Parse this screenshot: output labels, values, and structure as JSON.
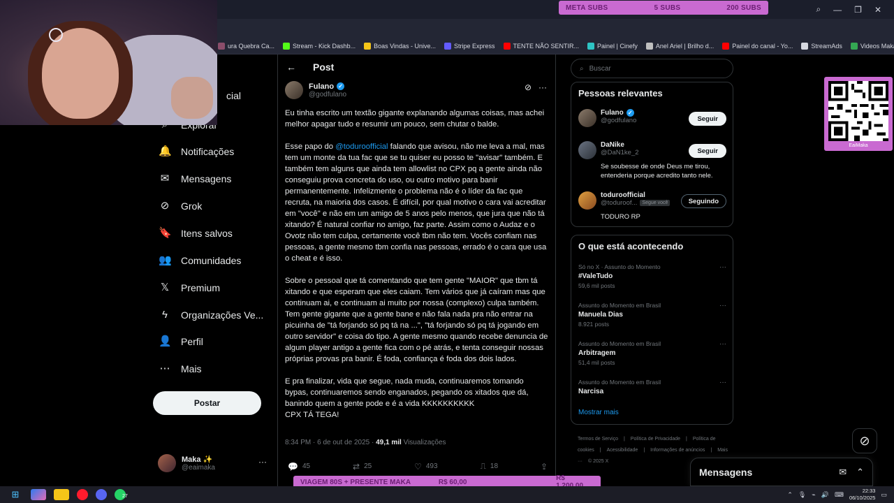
{
  "browser": {
    "bookmarks": [
      {
        "label": "ura Quebra Ca...",
        "icon": "bookmark-icon",
        "color": "#8b4d6a"
      },
      {
        "label": "Stream - Kick Dashb...",
        "icon": "kick-icon",
        "color": "#53fc18"
      },
      {
        "label": "Boas Vindas - Unive...",
        "icon": "star-icon",
        "color": "#f5c518"
      },
      {
        "label": "Stripe Express",
        "icon": "stripe-icon",
        "color": "#635bff"
      },
      {
        "label": "TENTE NÃO SENTIR...",
        "icon": "youtube-icon",
        "color": "#ff0000"
      },
      {
        "label": "Painel | Cinefy",
        "icon": "cinefy-icon",
        "color": "#2ec4c4"
      },
      {
        "label": "Anel Ariel | Brilho d...",
        "icon": "circle-icon",
        "color": "#bfbfbf"
      },
      {
        "label": "Painel do canal - Yo...",
        "icon": "youtube-icon",
        "color": "#ff0000"
      },
      {
        "label": "StreamAds",
        "icon": "file-icon",
        "color": "#d6d8e0"
      },
      {
        "label": "Videos Maka - Goo...",
        "icon": "drive-icon",
        "color": "#34a853"
      }
    ]
  },
  "overlay": {
    "meta_label": "META SUBS",
    "meta_current": "5 SUBS",
    "meta_goal": "200 SUBS",
    "viagem_label": "VIAGEM 80S + PRESENTE MAKA",
    "viagem_current": "R$ 60,00",
    "viagem_goal": "R$ 1.200,00",
    "qr_label": "EaiMaka"
  },
  "nav": {
    "partial_top": "cial",
    "partial_explore": "Explorar",
    "items": [
      {
        "label": "Notificações",
        "icon": "bell-icon",
        "glyph": "🔔"
      },
      {
        "label": "Mensagens",
        "icon": "mail-icon",
        "glyph": "✉"
      },
      {
        "label": "Grok",
        "icon": "grok-icon",
        "glyph": "⊘"
      },
      {
        "label": "Itens salvos",
        "icon": "bookmark-icon",
        "glyph": "🔖"
      },
      {
        "label": "Comunidades",
        "icon": "communities-icon",
        "glyph": "👥"
      },
      {
        "label": "Premium",
        "icon": "x-logo-icon",
        "glyph": "𝕏"
      },
      {
        "label": "Organizações Ve...",
        "icon": "lightning-icon",
        "glyph": "ϟ"
      },
      {
        "label": "Perfil",
        "icon": "person-icon",
        "glyph": "👤"
      },
      {
        "label": "Mais",
        "icon": "more-circle-icon",
        "glyph": "⋯"
      }
    ],
    "post_button": "Postar",
    "account": {
      "name": "Maka ✨",
      "handle": "@eaimaka",
      "more": "···"
    }
  },
  "post": {
    "header": "Post",
    "author_name": "Fulano",
    "author_handle": "@godfulano",
    "paragraphs": [
      "Eu tinha escrito um textão gigante explanando algumas coisas, mas achei melhor apagar tudo e resumir um pouco, sem chutar o balde.",
      "falando que avisou, não me leva a mal, mas tem um monte da tua fac que se tu quiser eu posso te \"avisar\" também. E também tem alguns que ainda tem allowlist no CPX pq a gente ainda não conseguiu prova concreta do uso, ou outro motivo para banir permanentemente. Infelizmente o problema não é o líder da fac que recruta, na maioria dos casos. É difícil, por qual motivo o cara vai acreditar em \"você\" e não em um amigo de 5 anos pelo menos, que jura que não tá xitando? É natural confiar no amigo, faz parte. Assim como o Audaz e o Ovotz não tem culpa, certamente você tbm não tem. Vocês confiam nas pessoas, a gente mesmo tbm confia nas pessoas, errado é o cara que usa o cheat e é isso.",
      "Sobre o pessoal que tá comentando que tem gente \"MAIOR\" que tbm tá xitando e que esperam que eles caiam. Tem vários que já caíram mas que continuam ai, e continuam ai muito por nossa (complexo) culpa também. Tem gente gigante que a gente bane e não fala nada pra não entrar na picuinha de \"tá forjando só pq tá na ...\", \"tá forjando só pq tá jogando em outro servidor\" e coisa do tipo. A gente mesmo quando recebe denuncia de algum player antigo a gente fica com o pé atrás, e tenta conseguir nossas próprias provas pra banir. É foda, confiança é foda dos dois lados.",
      "E pra finalizar, vida que segue, nada muda, continuaremos tomando bypas, continuaremos sendo enganados, pegando os xitados que dá, banindo quem a gente pode e é a vida KKKKKKKKKK\nCPX TÁ TEGA!"
    ],
    "p2_prefix": "Esse papo do ",
    "p2_mention": "@toduroofficial",
    "timestamp": "8:34 PM · 6 de out de 2025 · ",
    "views_count": "49,1 mil",
    "views_label": " Visualizações",
    "replies": "45",
    "reposts": "25",
    "likes": "493",
    "bookmarks": "18"
  },
  "sidebar": {
    "search_placeholder": "Buscar",
    "relevant_title": "Pessoas relevantes",
    "people": [
      {
        "name": "Fulano",
        "handle": "@godfulano",
        "verified": true,
        "bio": "",
        "button": "Seguir",
        "follows_you": ""
      },
      {
        "name": "DaNike",
        "handle": "@DaN1ke_2",
        "verified": false,
        "bio": "Se soubesse de onde Deus me tirou, entenderia porque acredito tanto nele.",
        "button": "Seguir",
        "follows_you": ""
      },
      {
        "name": "toduroofficial",
        "handle": "@toduroof...",
        "verified": false,
        "bio": "TODURO RP",
        "button": "Seguindo",
        "follows_you": "Segue você"
      }
    ],
    "trends_title": "O que está acontecendo",
    "trends": [
      {
        "context": "Só no X · Assunto do Momento",
        "name": "#ValeTudo",
        "count": "59,6 mil posts"
      },
      {
        "context": "Assunto do Momento em Brasil",
        "name": "Manuela Dias",
        "count": "8.921 posts"
      },
      {
        "context": "Assunto do Momento em Brasil",
        "name": "Arbitragem",
        "count": "51,4 mil posts"
      },
      {
        "context": "Assunto do Momento em Brasil",
        "name": "Narcisa",
        "count": ""
      }
    ],
    "show_more": "Mostrar mais",
    "footer": [
      "Termos de Serviço",
      "|",
      "Política de Privacidade",
      "|",
      "Política de cookies",
      "|",
      "Acessibilidade",
      "|",
      "Informações de anúncios",
      "|",
      "Mais ···",
      "© 2025 X"
    ]
  },
  "messages_drawer": {
    "title": "Mensagens"
  },
  "taskbar": {
    "time": "22:33",
    "date": "06/10/2025",
    "whatsapp_badge": "27"
  }
}
